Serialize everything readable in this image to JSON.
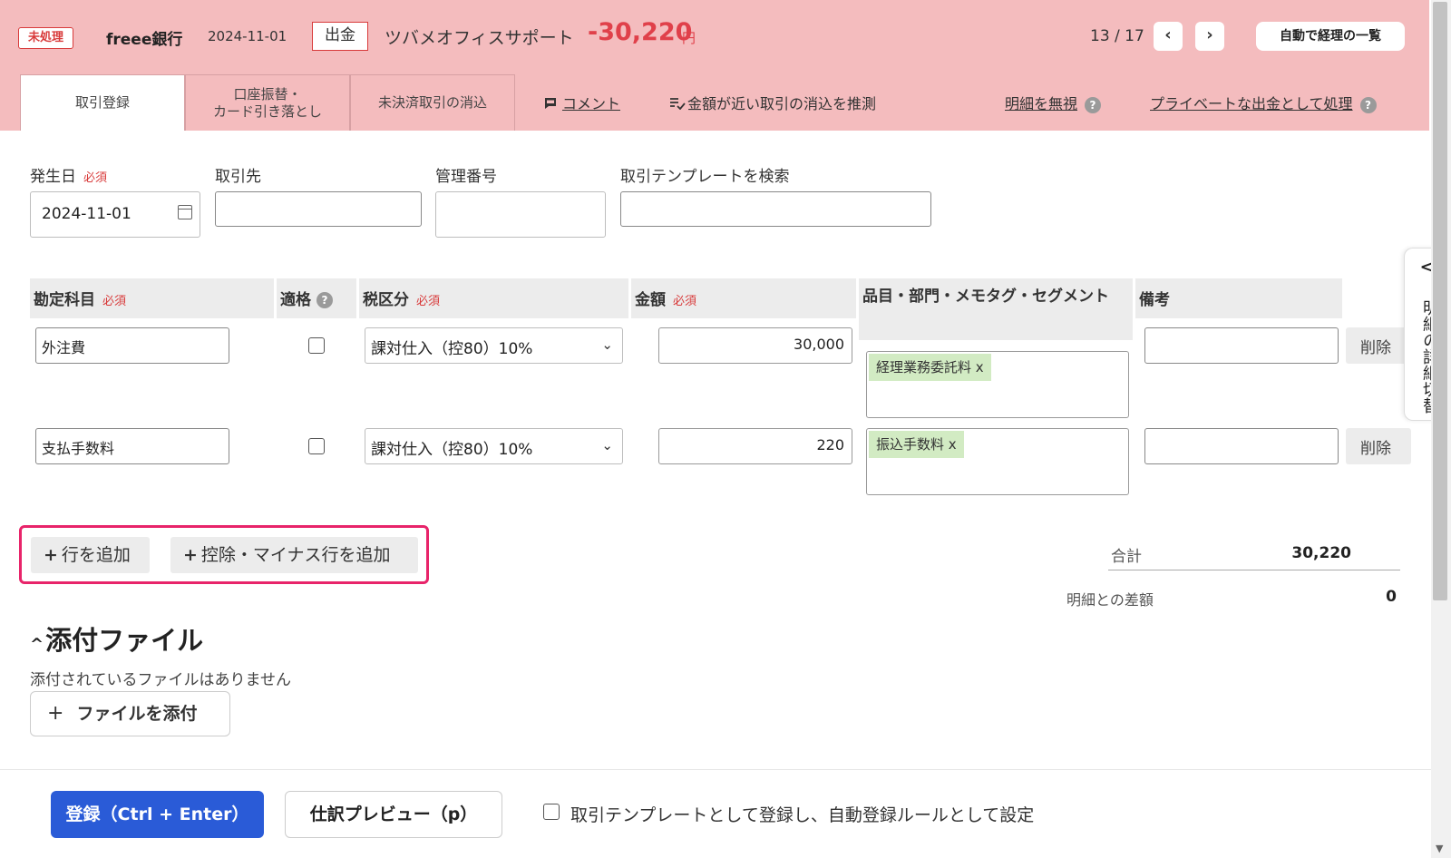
{
  "header": {
    "status_badge": "未処理",
    "bank": "freee銀行",
    "date": "2024-11-01",
    "kind": "出金",
    "payee": "ツバメオフィスサポート",
    "amount": "-30,220",
    "currency": "円",
    "pager": "13 / 17",
    "prev_label": "‹",
    "next_label": "›",
    "auto_list": "自動で経理の一覧",
    "tabs": [
      {
        "label": "取引登録"
      },
      {
        "label": "口座振替・\nカード引き落とし"
      },
      {
        "label": "未決済取引の消込"
      }
    ],
    "comment": "コメント",
    "guess": "金額が近い取引の消込を推測",
    "ignore": "明細を無視",
    "private": "プライベートな出金として処理",
    "help": "?"
  },
  "form": {
    "date_label": "発生日",
    "required": "必須",
    "date_value": "2024-11-01",
    "partner_label": "取引先",
    "partner_value": "",
    "mgmt_label": "管理番号",
    "mgmt_value": "",
    "template_label": "取引テンプレートを検索",
    "template_value": ""
  },
  "table": {
    "headers": {
      "account": "勘定科目",
      "qualified": "適格",
      "tax": "税区分",
      "amount": "金額",
      "items": "品目・部門・メモタグ・セグメント",
      "note": "備考"
    },
    "rows": [
      {
        "account": "外注費",
        "tax": "課対仕入（控80）10%",
        "amount": "30,000",
        "tag": "経理業務委託料 x",
        "note": "",
        "delete": "削除"
      },
      {
        "account": "支払手数料",
        "tax": "課対仕入（控80）10%",
        "amount": "220",
        "tag": "振込手数料 x",
        "note": "",
        "delete": "削除"
      }
    ]
  },
  "actions": {
    "add_row": "行を追加",
    "add_minus_row": "控除・マイナス行を追加",
    "plus": "+"
  },
  "totals": {
    "total_label": "合計",
    "total_value": "30,220",
    "diff_label": "明細との差額",
    "diff_value": "0"
  },
  "attachments": {
    "title": "添付ファイル",
    "empty": "添付されているファイルはありません",
    "attach_button": "ファイルを添付",
    "caret": "^",
    "plus": "+"
  },
  "drawer": {
    "label": "明細の詳細切替",
    "arrow": "<"
  },
  "footer": {
    "save": "登録（Ctrl + Enter）",
    "preview": "仕訳プレビュー（p）",
    "template_checkbox": "取引テンプレートとして登録し、自動登録ルールとして設定"
  },
  "icons": {
    "calendar": "calendar-icon",
    "comment": "comment-icon",
    "guess": "list-check-icon",
    "help": "help-icon",
    "chevron": "chevron-down-icon"
  },
  "colors": {
    "header_bg": "#f4bcbe",
    "accent_red": "#e0404a",
    "primary_blue": "#2a5bd7",
    "tag_green": "#d2ebc3",
    "highlight": "#e8246a"
  }
}
